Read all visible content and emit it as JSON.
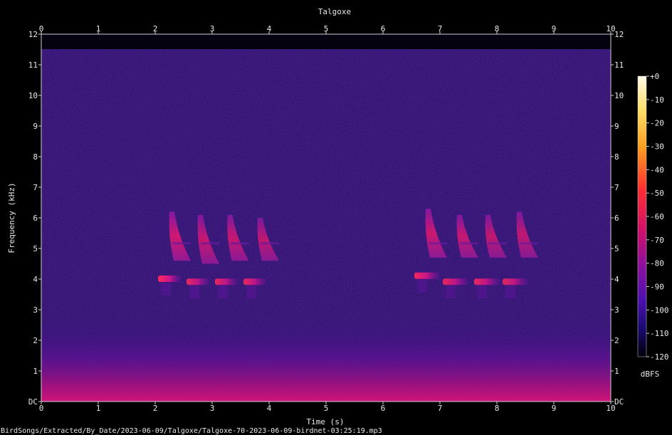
{
  "chart_data": {
    "type": "heatmap",
    "title": "Talgoxe",
    "xlabel": "Time (s)",
    "ylabel": "Frequency (kHz)",
    "xlim": [
      0,
      10
    ],
    "ylim": [
      0,
      12
    ],
    "x_ticks": [
      "0",
      "1",
      "2",
      "3",
      "4",
      "5",
      "6",
      "7",
      "8",
      "9",
      "10"
    ],
    "y_ticks": [
      "DC",
      "1",
      "2",
      "3",
      "4",
      "5",
      "6",
      "7",
      "8",
      "9",
      "10",
      "11",
      "12"
    ],
    "colorbar": {
      "unit": "dBFS",
      "ticks": [
        "+0",
        "-10",
        "-20",
        "-30",
        "-40",
        "-50",
        "-60",
        "-70",
        "-80",
        "-90",
        "-100",
        "-110",
        "-120"
      ],
      "range": [
        -120,
        0
      ]
    },
    "colors": {
      "background": "#000000",
      "noise": "#2a0a6e",
      "low_band": "#c0107a",
      "call_peak": "#ff1a6a",
      "call_mid": "#b01a9c"
    },
    "calls": [
      {
        "t": 2.25,
        "type": "sweep",
        "f_hi": 6.2,
        "f_lo": 4.6,
        "level": -60
      },
      {
        "t": 2.75,
        "type": "sweep",
        "f_hi": 6.1,
        "f_lo": 4.5,
        "level": -64
      },
      {
        "t": 3.27,
        "type": "sweep",
        "f_hi": 6.1,
        "f_lo": 4.6,
        "level": -64
      },
      {
        "t": 3.8,
        "type": "sweep",
        "f_hi": 6.0,
        "f_lo": 4.6,
        "level": -66
      },
      {
        "t": 2.05,
        "type": "tone",
        "f": 4.0,
        "len": 0.4,
        "level": -55
      },
      {
        "t": 2.55,
        "type": "tone",
        "f": 3.9,
        "len": 0.4,
        "level": -62
      },
      {
        "t": 3.05,
        "type": "tone",
        "f": 3.9,
        "len": 0.4,
        "level": -62
      },
      {
        "t": 3.55,
        "type": "tone",
        "f": 3.9,
        "len": 0.4,
        "level": -62
      },
      {
        "t": 6.75,
        "type": "sweep",
        "f_hi": 6.3,
        "f_lo": 4.7,
        "level": -62
      },
      {
        "t": 7.3,
        "type": "sweep",
        "f_hi": 6.1,
        "f_lo": 4.7,
        "level": -64
      },
      {
        "t": 7.8,
        "type": "sweep",
        "f_hi": 6.1,
        "f_lo": 4.7,
        "level": -66
      },
      {
        "t": 8.35,
        "type": "sweep",
        "f_hi": 6.2,
        "f_lo": 4.7,
        "level": -66
      },
      {
        "t": 6.55,
        "type": "tone",
        "f": 4.1,
        "len": 0.45,
        "level": -58
      },
      {
        "t": 7.05,
        "type": "tone",
        "f": 3.9,
        "len": 0.45,
        "level": -62
      },
      {
        "t": 7.6,
        "type": "tone",
        "f": 3.9,
        "len": 0.45,
        "level": -62
      },
      {
        "t": 8.1,
        "type": "tone",
        "f": 3.9,
        "len": 0.45,
        "level": -64
      }
    ],
    "annotations": [
      "BirdSongs/Extracted/By_Date/2023-06-09/Talgoxe/Talgoxe-70-2023-06-09-birdnet-03:25:19.mp3"
    ]
  }
}
